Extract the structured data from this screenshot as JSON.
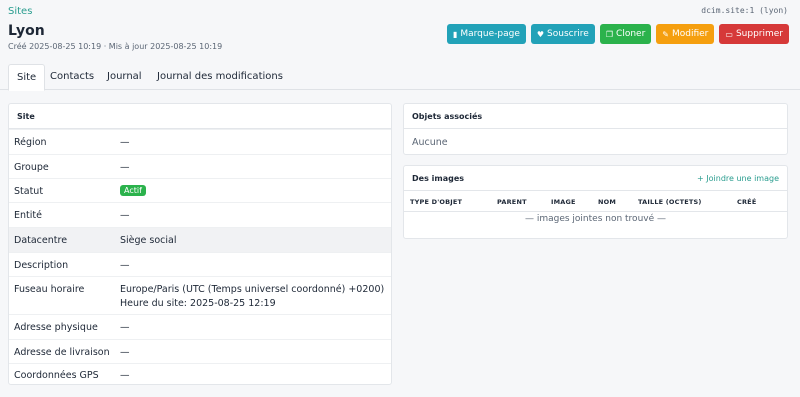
{
  "breadcrumb": "Sites",
  "object_id": "dcim.site:1 (lyon)",
  "title": "Lyon",
  "meta": "Créé 2025-08-25 10:19 · Mis à jour 2025-08-25 10:19",
  "actions": {
    "bookmark": "Marque-page",
    "subscribe": "Souscrire",
    "clone": "Cloner",
    "edit": "Modifier",
    "delete": "Supprimer"
  },
  "tabs": [
    "Site",
    "Contacts",
    "Journal",
    "Journal des modifications"
  ],
  "site_card": {
    "header": "Site",
    "rows": [
      {
        "label": "Région",
        "value": "—"
      },
      {
        "label": "Groupe",
        "value": "—"
      },
      {
        "label": "Statut",
        "value": "Actif"
      },
      {
        "label": "Entité",
        "value": "—"
      },
      {
        "label": "Datacentre",
        "value": "Siège social"
      },
      {
        "label": "Description",
        "value": "—"
      },
      {
        "label": "Fuseau horaire",
        "value": "Europe/Paris (UTC (Temps universel coordonné) +0200)",
        "sub": "Heure du site: 2025-08-25 12:19"
      },
      {
        "label": "Adresse physique",
        "value": "—"
      },
      {
        "label": "Adresse de livraison",
        "value": "—"
      },
      {
        "label": "Coordonnées GPS",
        "value": "—"
      }
    ]
  },
  "related": {
    "header": "Objets associés",
    "empty": "Aucune"
  },
  "images": {
    "header": "Des images",
    "attach": "Joindre une image",
    "columns": [
      "TYPE D'OBJET",
      "PARENT",
      "IMAGE",
      "NOM",
      "TAILLE (OCTETS)",
      "CRÉÉ"
    ],
    "empty": "— images jointes non trouvé —"
  },
  "colors": {
    "teal": "#22a2b8",
    "green": "#2bb24c",
    "orange": "#f59f0f",
    "red": "#d63939"
  }
}
